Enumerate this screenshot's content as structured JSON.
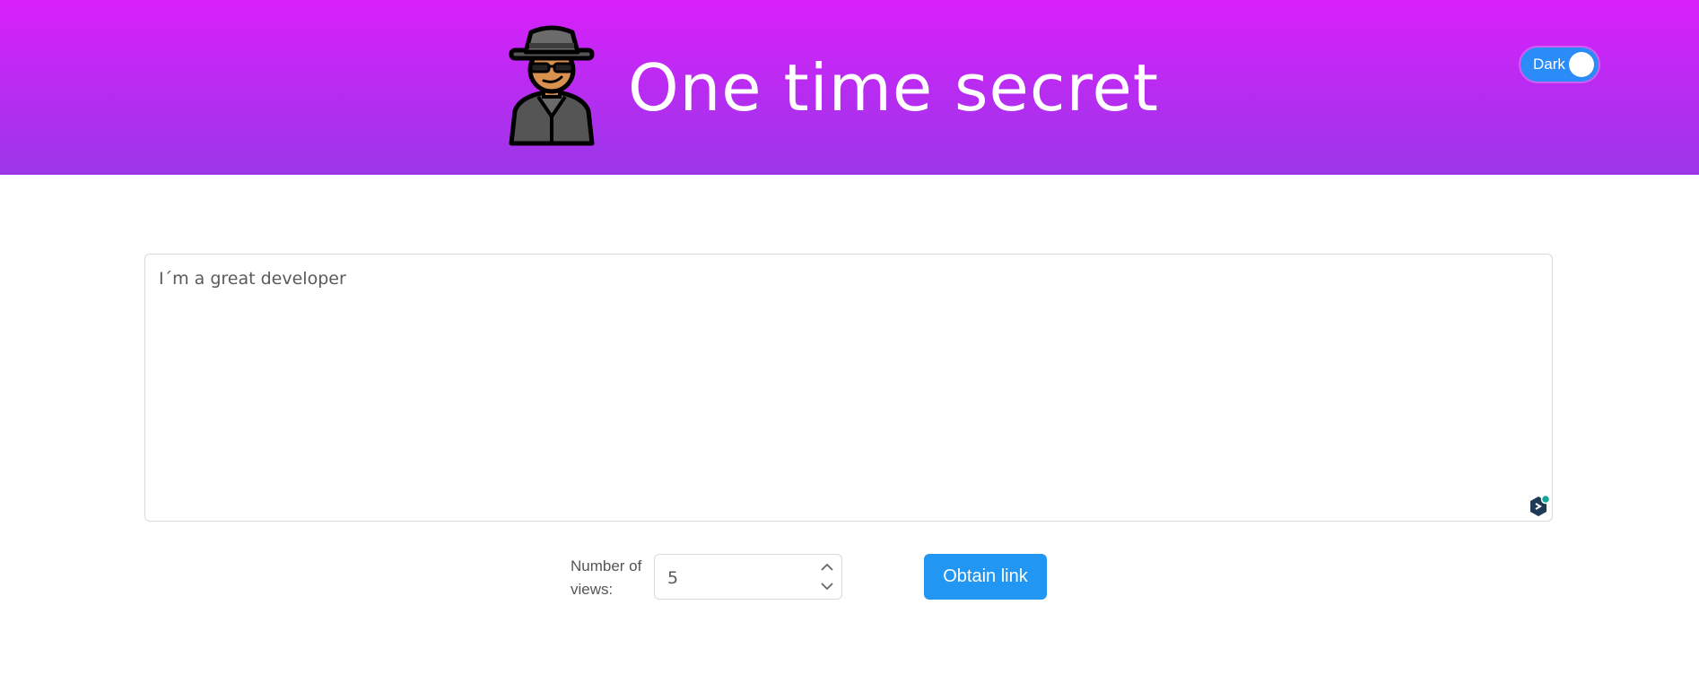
{
  "header": {
    "title": "One time secret",
    "logo_icon": "spy-agent-icon",
    "background_gradient": [
      "#d820fb",
      "#9b37e8"
    ]
  },
  "theme_toggle": {
    "label": "Dark",
    "state": "on",
    "color": "#2b8cf7"
  },
  "secret": {
    "value": "I´m a great developer",
    "helper_icon": "grammar-assistant-icon"
  },
  "views": {
    "label": "Number of views:",
    "value": "5"
  },
  "actions": {
    "obtain_label": "Obtain link",
    "color": "#2196f3"
  }
}
